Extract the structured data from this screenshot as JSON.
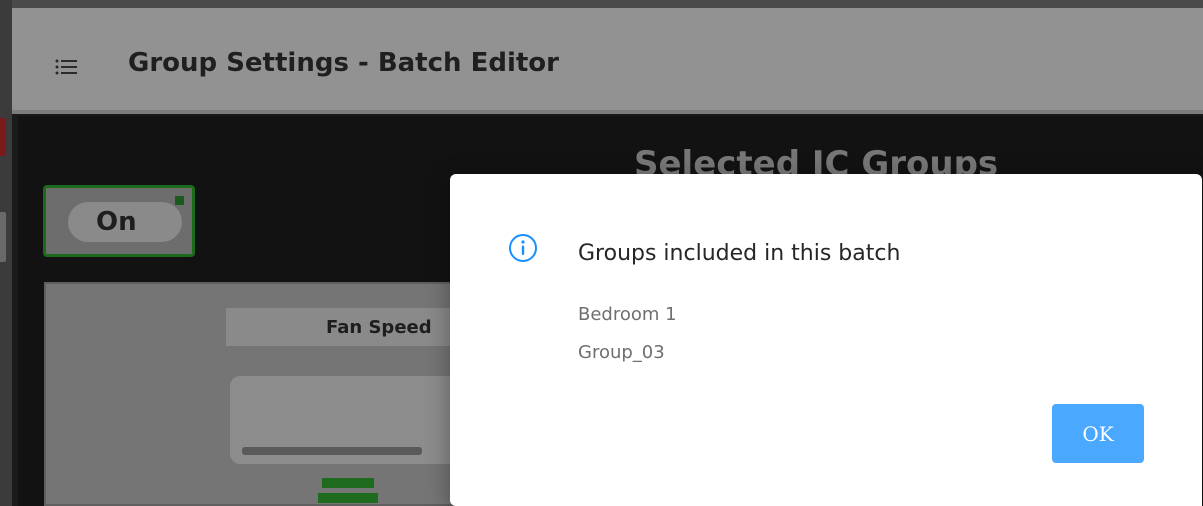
{
  "header": {
    "title": "Group Settings - Batch Editor",
    "menu_icon": "list-menu-icon"
  },
  "main": {
    "section_title": "Selected IC Groups",
    "power_toggle_label": "On",
    "fan_speed_label": "Fan Speed"
  },
  "dialog": {
    "icon": "info-circle-icon",
    "title": "Groups included in this batch",
    "groups": [
      "Bedroom 1",
      "Group_03"
    ],
    "ok_label": "OK"
  },
  "colors": {
    "accent": "#4aa8ff",
    "info_icon": "#1890ff",
    "toggle_border": "#1b6b1b"
  }
}
